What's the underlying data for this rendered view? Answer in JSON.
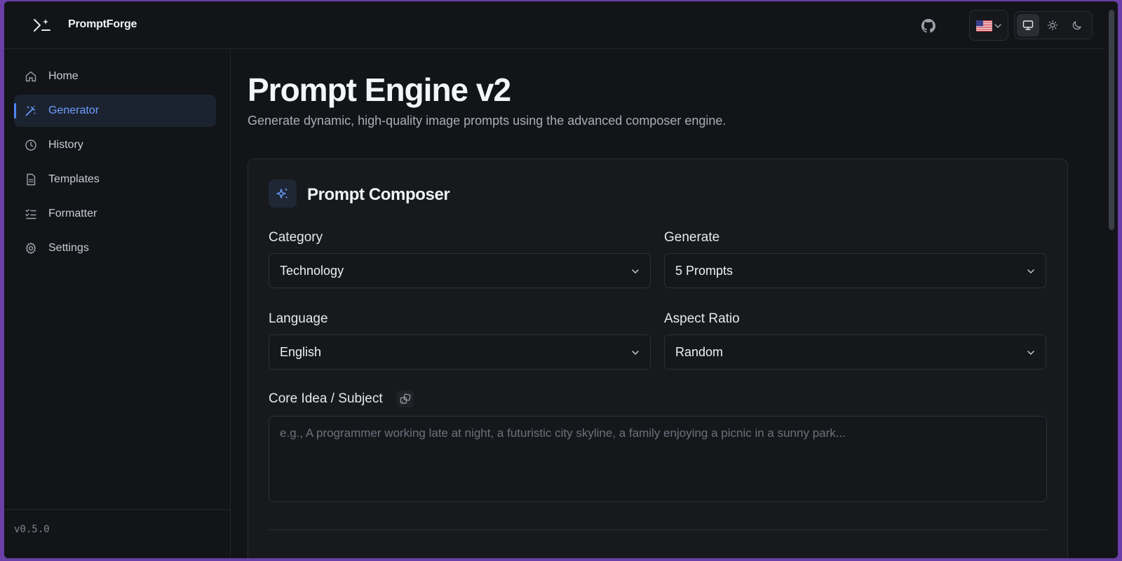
{
  "header": {
    "brand": "PromptForge",
    "icons": {
      "logo": "terminal-sparkle-icon",
      "github": "github-icon",
      "language": "us-flag-icon",
      "theme_system": "monitor-icon",
      "theme_light": "sun-icon",
      "theme_dark": "moon-icon"
    },
    "active_theme": "system"
  },
  "sidebar": {
    "items": [
      {
        "label": "Home",
        "icon": "home-icon",
        "active": false
      },
      {
        "label": "Generator",
        "icon": "magic-wand-icon",
        "active": true
      },
      {
        "label": "History",
        "icon": "clock-icon",
        "active": false
      },
      {
        "label": "Templates",
        "icon": "document-icon",
        "active": false
      },
      {
        "label": "Formatter",
        "icon": "list-check-icon",
        "active": false
      },
      {
        "label": "Settings",
        "icon": "gear-icon",
        "active": false
      }
    ],
    "version": "v0.5.0"
  },
  "main": {
    "title": "Prompt Engine v2",
    "subtitle": "Generate dynamic, high-quality image prompts using the advanced composer engine.",
    "composer": {
      "title": "Prompt Composer",
      "icon": "sparkles-icon",
      "category": {
        "label": "Category",
        "value": "Technology"
      },
      "generate": {
        "label": "Generate",
        "value": "5 Prompts"
      },
      "language": {
        "label": "Language",
        "value": "English"
      },
      "aspect_ratio": {
        "label": "Aspect Ratio",
        "value": "Random"
      },
      "core_idea": {
        "label": "Core Idea / Subject",
        "placeholder": "e.g., A programmer working late at night, a futuristic city skyline, a family enjoying a picnic in a sunny park..."
      }
    }
  },
  "colors": {
    "accent": "#4f86f7",
    "background": "#121418",
    "window_frame": "#6b3fa8"
  }
}
